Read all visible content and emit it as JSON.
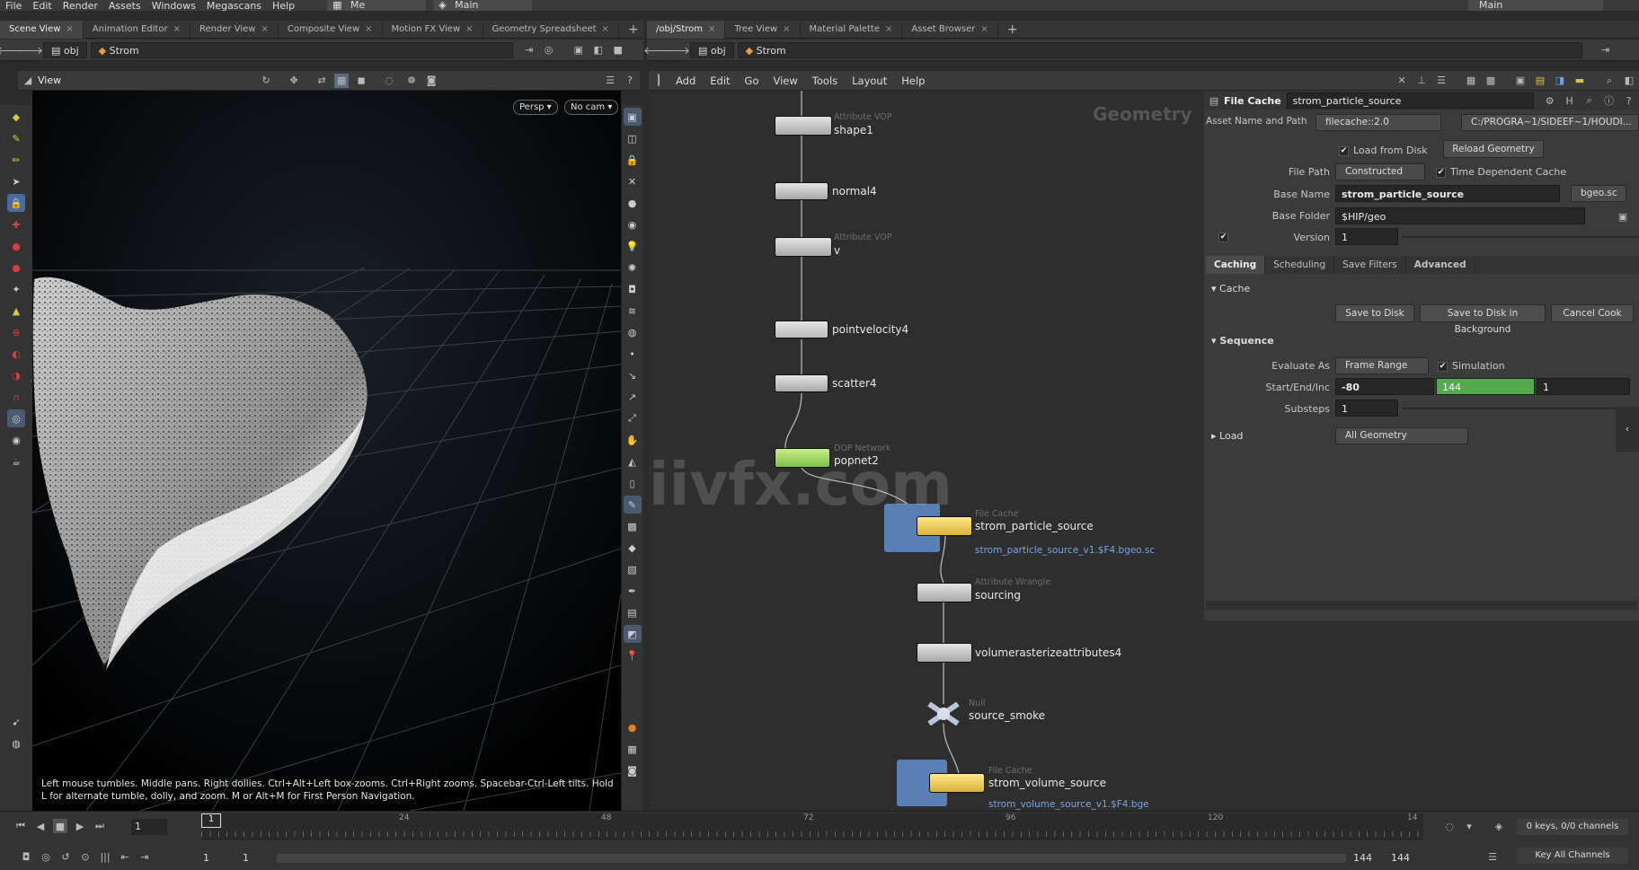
{
  "menubar": {
    "items": [
      "File",
      "Edit",
      "Render",
      "Assets",
      "Windows",
      "Megascans",
      "Help"
    ],
    "desktop_label": "Me",
    "context_label": "Main",
    "right_label": "Main"
  },
  "left_pane": {
    "tabs": [
      "Scene View",
      "Animation Editor",
      "Render View",
      "Composite View",
      "Motion FX View",
      "Geometry Spreadsheet"
    ],
    "path_root": "obj",
    "path_node": "Strom",
    "view_label": "View",
    "persp": "Persp",
    "cam": "No cam",
    "hint": "Left mouse tumbles. Middle pans. Right dollies. Ctrl+Alt+Left box-zooms. Ctrl+Right zooms. Spacebar-Ctrl-Left tilts. Hold L for alternate tumble, dolly, and zoom.    M or Alt+M for First Person Navigation."
  },
  "right_pane": {
    "tabs": [
      "/obj/Strom",
      "Tree View",
      "Material Palette",
      "Asset Browser"
    ],
    "path_root": "obj",
    "path_node": "Strom",
    "menu": [
      "Add",
      "Edit",
      "Go",
      "View",
      "Tools",
      "Layout",
      "Help"
    ],
    "context_watermark": "Geometry"
  },
  "network": {
    "watermark": "iivfx.com",
    "nodes": [
      {
        "name": "shape1",
        "type": "Attribute VOP"
      },
      {
        "name": "normal4",
        "type": ""
      },
      {
        "name": "v",
        "type": "Attribute VOP"
      },
      {
        "name": "pointvelocity4",
        "type": ""
      },
      {
        "name": "scatter4",
        "type": ""
      },
      {
        "name": "popnet2",
        "type": "DOP Network"
      },
      {
        "name": "strom_particle_source",
        "type": "File Cache",
        "file": "strom_particle_source_v1.$F4.bgeo.sc"
      },
      {
        "name": "sourcing",
        "type": "Attribute Wrangle"
      },
      {
        "name": "volumerasterizeattributes4",
        "type": ""
      },
      {
        "name": "source_smoke",
        "type": "Null"
      },
      {
        "name": "strom_volume_source",
        "type": "File Cache",
        "file": "strom_volume_source_v1.$F4.bge"
      }
    ]
  },
  "params": {
    "header_type": "File Cache",
    "header_name": "strom_particle_source",
    "asset_label": "Asset Name and Path",
    "asset_value": "filecache::2.0",
    "asset_path": "C:/PROGRA~1/SIDEEF~1/HOUDI...",
    "load_from_disk": "Load from Disk",
    "reload_geometry": "Reload Geometry",
    "file_path_label": "File Path",
    "file_path_value": "Constructed",
    "time_dependent": "Time Dependent Cache",
    "base_name_label": "Base Name",
    "base_name_value": "strom_particle_source",
    "ext_value": "bgeo.sc",
    "base_folder_label": "Base Folder",
    "base_folder_value": "$HIP/geo",
    "version_label": "Version",
    "version_value": "1",
    "tabs": [
      "Caching",
      "Scheduling",
      "Save Filters",
      "Advanced"
    ],
    "cache_section": "Cache",
    "save_to_disk": "Save to Disk",
    "save_bg": "Save to Disk in Background",
    "cancel_cook": "Cancel Cook",
    "sequence_section": "Sequence",
    "evaluate_label": "Evaluate As",
    "evaluate_value": "Frame Range",
    "simulation": "Simulation",
    "start_end_label": "Start/End/Inc",
    "start": "-80",
    "end": "144",
    "inc": "1",
    "substeps_label": "Substeps",
    "substeps_value": "1",
    "load_section": "Load",
    "load_value": "All Geometry"
  },
  "timeline": {
    "current_frame": "1",
    "ticks": [
      "24",
      "48",
      "72",
      "96",
      "120",
      "14"
    ],
    "start_frame": "1",
    "start_frame2": "1",
    "end_frame": "144",
    "end_frame2": "144",
    "keys_info": "0 keys, 0/0 channels",
    "key_all": "Key All Channels"
  }
}
